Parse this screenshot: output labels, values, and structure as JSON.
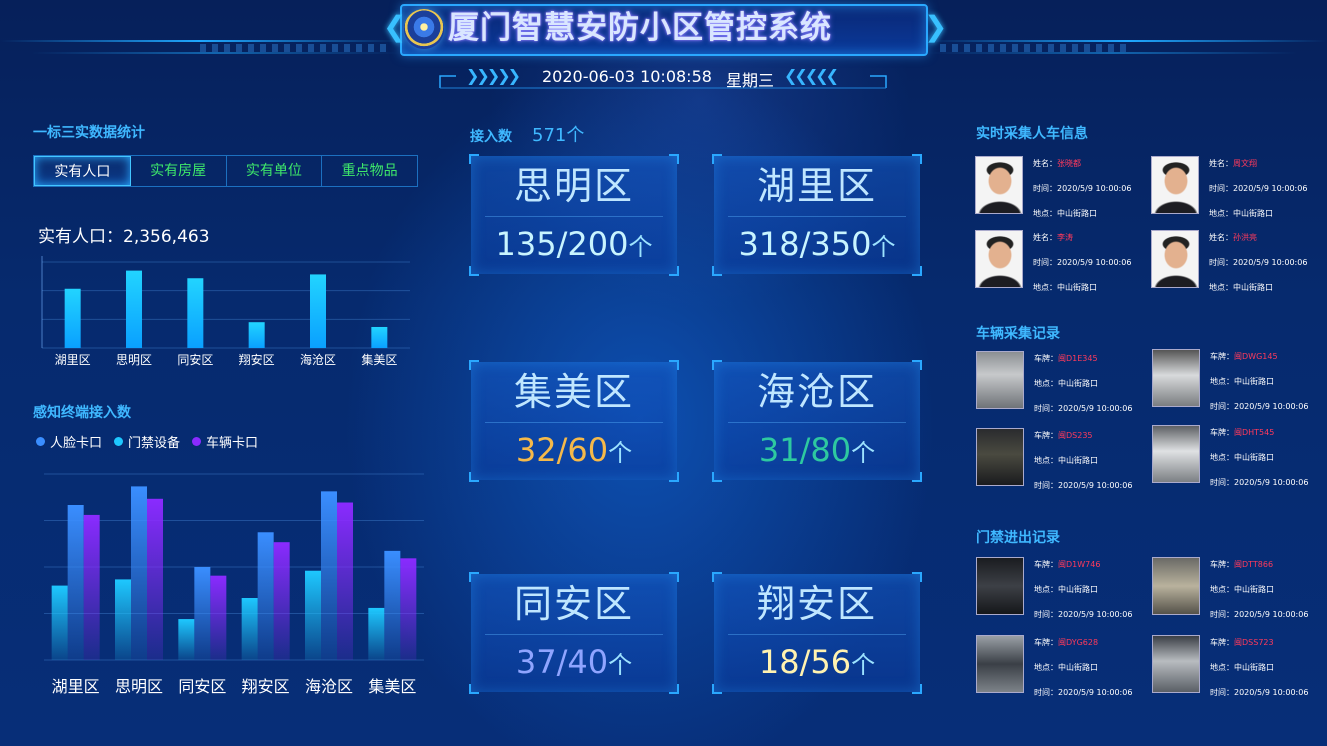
{
  "header": {
    "title": "厦门智慧安防小区管控系统",
    "date": "2020-06-03 10:08:58",
    "weekday": "星期三"
  },
  "left": {
    "stats_title": "一标三实数据统计",
    "tabs": [
      "实有人口",
      "实有房屋",
      "实有单位",
      "重点物品"
    ],
    "active_tab": "实有人口",
    "population_label": "实有人口：2,356,463",
    "sensor_title": "感知终端接入数",
    "legend": [
      "人脸卡口",
      "门禁设备",
      "车辆卡口"
    ]
  },
  "chart_data": [
    {
      "type": "bar",
      "categories": [
        "湖里区",
        "思明区",
        "同安区",
        "翔安区",
        "海沧区",
        "集美区"
      ],
      "series": [
        {
          "values": [
            62,
            81,
            73,
            27,
            77,
            22
          ]
        }
      ],
      "ylim": [
        0,
        90
      ],
      "grid": true,
      "colors": [
        "#19c6ff"
      ]
    },
    {
      "type": "bar",
      "categories": [
        "湖里区",
        "思明区",
        "同安区",
        "翔安区",
        "海沧区",
        "集美区"
      ],
      "series": [
        {
          "name": "人脸卡口",
          "values": [
            60,
            65,
            33,
            50,
            72,
            42
          ]
        },
        {
          "name": "门禁设备",
          "values": [
            125,
            140,
            75,
            103,
            136,
            88
          ]
        },
        {
          "name": "车辆卡口",
          "values": [
            117,
            130,
            68,
            95,
            127,
            82
          ]
        }
      ],
      "ylim": [
        0,
        150
      ],
      "legend": "top-left",
      "grid": true,
      "colors": [
        "#1ec8ff",
        "#3a8eff",
        "#8a2bff"
      ]
    }
  ],
  "center": {
    "access_label": "接入数",
    "access_value": "571个",
    "unit": "个",
    "districts": [
      {
        "name": "思明区",
        "value": "135/200",
        "color": "#c8f4ff"
      },
      {
        "name": "湖里区",
        "value": "318/350",
        "color": "#c8f4ff"
      },
      {
        "name": "集美区",
        "value": "32/60",
        "color": "#f5b94a"
      },
      {
        "name": "海沧区",
        "value": "31/80",
        "color": "#2ec9a0"
      },
      {
        "name": "同安区",
        "value": "37/40",
        "color": "#8fa4ff"
      },
      {
        "name": "翔安区",
        "value": "18/56",
        "color": "#fff2b0"
      }
    ]
  },
  "right": {
    "person_title": "实时采集人车信息",
    "persons": [
      {
        "name_k": "姓名：",
        "name": "张晓都",
        "time_k": "时间：",
        "time": "2020/5/9 10:00:06",
        "place_k": "地点：",
        "place": "中山街路口"
      },
      {
        "name_k": "姓名：",
        "name": "周文翔",
        "time_k": "时间：",
        "time": "2020/5/9 10:00:06",
        "place_k": "地点：",
        "place": "中山街路口"
      },
      {
        "name_k": "姓名：",
        "name": "李涛",
        "time_k": "时间：",
        "time": "2020/5/9 10:00:06",
        "place_k": "地点：",
        "place": "中山街路口"
      },
      {
        "name_k": "姓名：",
        "name": "孙洪亮",
        "time_k": "时间：",
        "time": "2020/5/9 10:00:06",
        "place_k": "地点：",
        "place": "中山街路口"
      }
    ],
    "vehicle_title": "车辆采集记录",
    "vehicles": [
      {
        "plate_k": "车牌：",
        "plate": "闽D1E345",
        "place_k": "地点：",
        "place": "中山街路口",
        "time_k": "时间：",
        "time": "2020/5/9 10:00:06"
      },
      {
        "plate_k": "车牌：",
        "plate": "闽DWG145",
        "place_k": "地点：",
        "place": "中山街路口",
        "time_k": "时间：",
        "time": "2020/5/9 10:00:06"
      },
      {
        "plate_k": "车牌：",
        "plate": "闽DS235",
        "place_k": "地点：",
        "place": "中山街路口",
        "time_k": "时间：",
        "time": "2020/5/9 10:00:06"
      },
      {
        "plate_k": "车牌：",
        "plate": "闽DHT545",
        "place_k": "地点：",
        "place": "中山街路口",
        "time_k": "时间：",
        "time": "2020/5/9 10:00:06"
      }
    ],
    "gate_title": "门禁进出记录",
    "gates": [
      {
        "plate_k": "车牌：",
        "plate": "闽D1W746",
        "place_k": "地点：",
        "place": "中山街路口",
        "time_k": "时间：",
        "time": "2020/5/9 10:00:06"
      },
      {
        "plate_k": "车牌：",
        "plate": "闽DTT866",
        "place_k": "地点：",
        "place": "中山街路口",
        "time_k": "时间：",
        "time": "2020/5/9 10:00:06"
      },
      {
        "plate_k": "车牌：",
        "plate": "闽DYG628",
        "place_k": "地点：",
        "place": "中山街路口",
        "time_k": "时间：",
        "time": "2020/5/9 10:00:06"
      },
      {
        "plate_k": "车牌：",
        "plate": "闽DSS723",
        "place_k": "地点：",
        "place": "中山街路口",
        "time_k": "时间：",
        "time": "2020/5/9 10:00:06"
      }
    ]
  }
}
